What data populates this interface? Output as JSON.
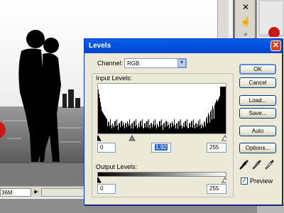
{
  "background": {
    "status_zoom": "36M",
    "status_arrow": "▶"
  },
  "dialog": {
    "title": "Levels",
    "close_glyph": "✕",
    "channel_label": "Channel:",
    "channel_value": "RGB",
    "channel_arrow": "▼",
    "input_levels_label": "Input Levels:",
    "input_black": "0",
    "input_gamma": "1.92",
    "input_white": "255",
    "output_levels_label": "Output Levels:",
    "output_black": "0",
    "output_white": "255",
    "buttons": {
      "ok": "OK",
      "cancel": "Cancel",
      "load": "Load...",
      "save": "Save...",
      "auto": "Auto",
      "options": "Options..."
    },
    "preview_label": "Preview",
    "preview_checked": true,
    "preview_check_glyph": "✓",
    "eyedroppers": [
      "black-point-eyedropper-icon",
      "gray-point-eyedropper-icon",
      "white-point-eyedropper-icon"
    ]
  },
  "colors": {
    "titlebar": "#0054e3",
    "close": "#d6451f",
    "selection": "#316ac5"
  }
}
